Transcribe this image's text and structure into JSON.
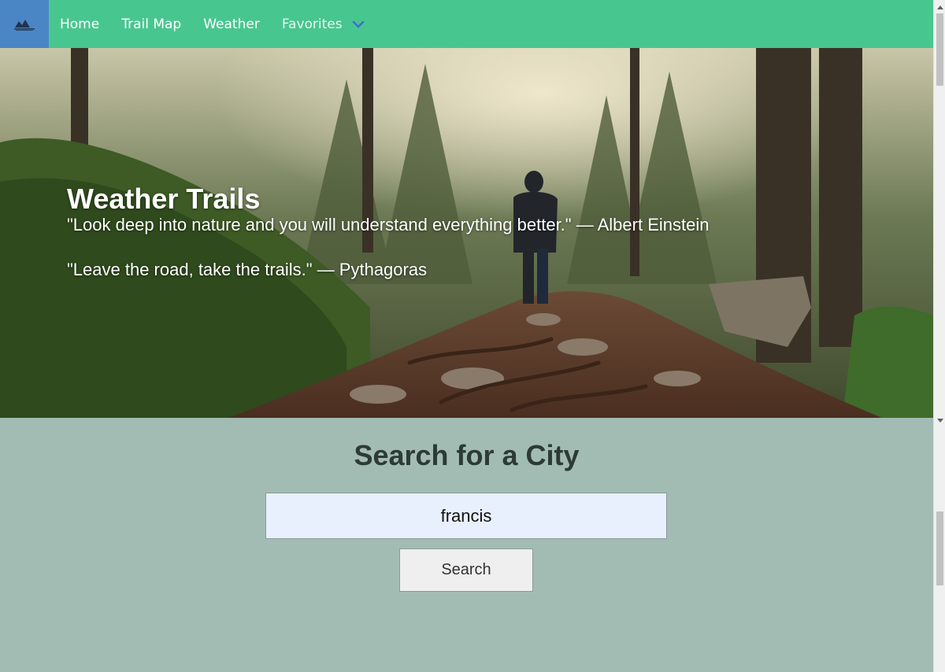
{
  "navbar": {
    "logo_icon": "mountain-logo-icon",
    "links": [
      {
        "label": "Home"
      },
      {
        "label": "Trail Map"
      },
      {
        "label": "Weather"
      },
      {
        "label": "Favorites"
      }
    ],
    "dropdown_icon": "chevron-down-icon",
    "colors": {
      "bar": "#48c690",
      "logo_bg": "#4a86c5",
      "chevron": "#3a6fd0"
    }
  },
  "hero": {
    "title": "Weather Trails",
    "quotes": [
      "\"Look deep into nature and you will understand everything better.\" — Albert Einstein",
      "\"Leave the road, take the trails.\" — Pythagoras"
    ],
    "image": "forest-trail-hiker"
  },
  "search": {
    "title": "Search for a City",
    "input_value": "francis",
    "button_label": "Search"
  }
}
